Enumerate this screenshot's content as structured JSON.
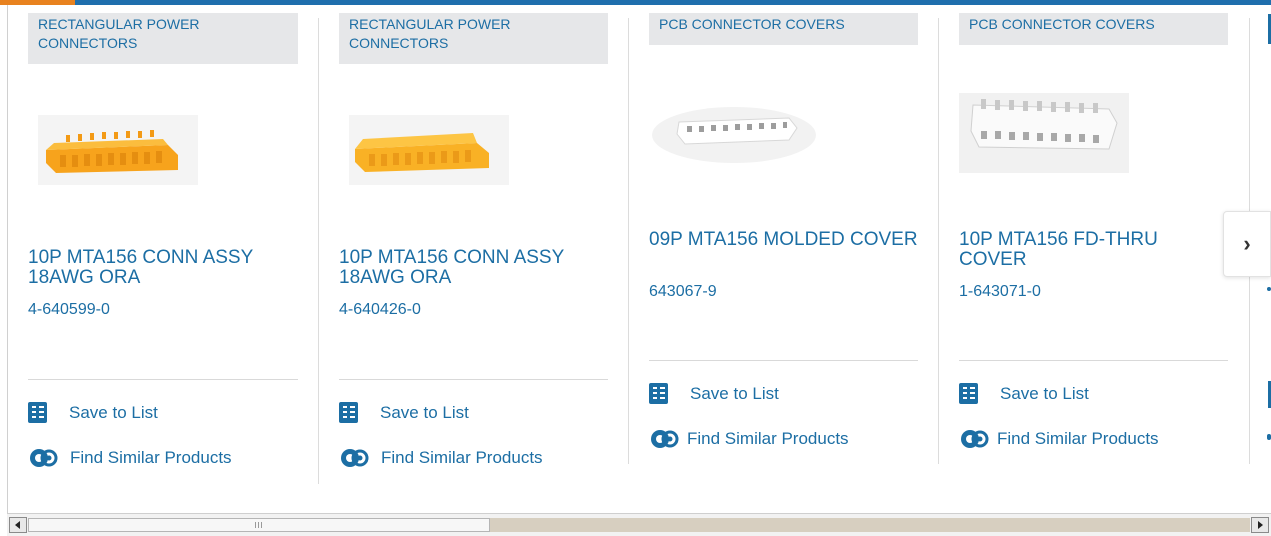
{
  "cards": [
    {
      "category": "RECTANGULAR POWER CONNECTORS",
      "title": "10P MTA156 CONN ASSY 18AWG ORA",
      "part_number": "4-640599-0",
      "save_label": "Save to List",
      "similar_label": "Find Similar Products",
      "image_color": "#f7a31c"
    },
    {
      "category": "RECTANGULAR POWER CONNECTORS",
      "title": "10P MTA156 CONN ASSY 18AWG ORA",
      "part_number": "4-640426-0",
      "save_label": "Save to List",
      "similar_label": "Find Similar Products",
      "image_color": "#f9b125"
    },
    {
      "category": "PCB CONNECTOR COVERS",
      "title": "09P MTA156 MOLDED COVER",
      "part_number": "643067-9",
      "save_label": "Save to List",
      "similar_label": "Find Similar Products",
      "image_color": "#e9e9e9"
    },
    {
      "category": "PCB CONNECTOR COVERS",
      "title": "10P MTA156 FD-THRU COVER",
      "part_number": "1-643071-0",
      "save_label": "Save to List",
      "similar_label": "Find Similar Products",
      "image_color": "#e6e6e6"
    }
  ],
  "carousel": {
    "next_icon": "chevron-right-icon",
    "next_glyph": "›"
  },
  "colors": {
    "accent": "#1c6ea4",
    "top_bar": "#1f6fad",
    "top_bar_accent": "#e8821f",
    "category_bg": "#e6e7e9"
  },
  "scrollbar": {
    "left_icon": "arrow-left-icon",
    "right_icon": "arrow-right-icon"
  }
}
